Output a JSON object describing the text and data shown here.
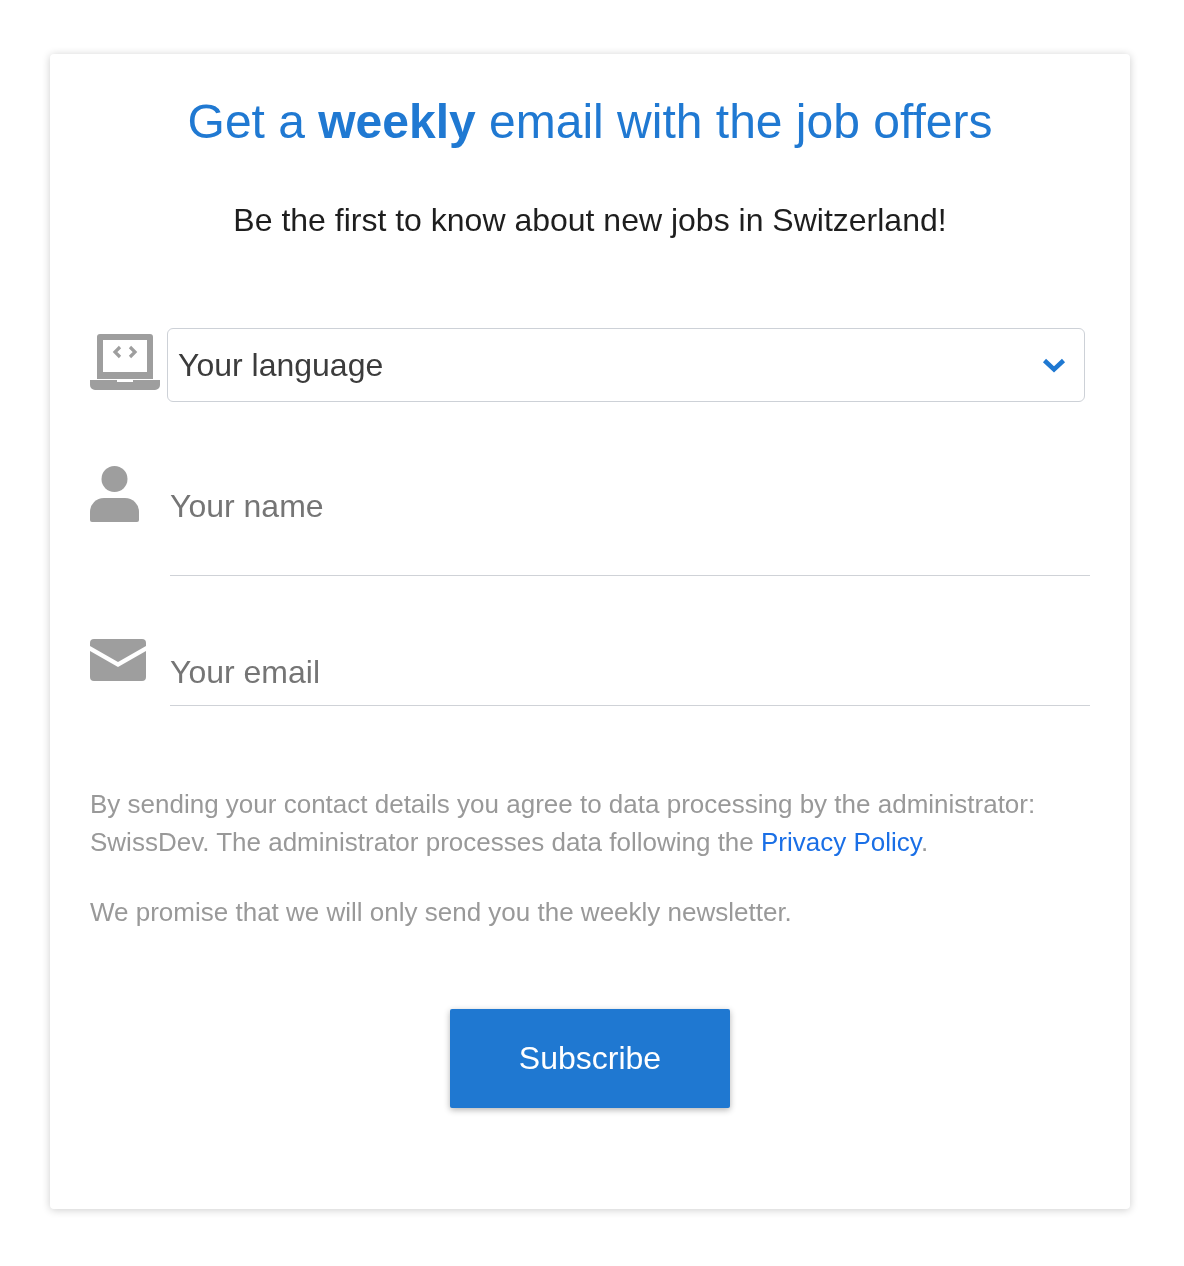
{
  "title": "Get a **weekly** email with the job offers",
  "subtitle": "Be the first to know about new jobs in Switzerland!",
  "fields": [
    {
      "kind": "select",
      "value": "Your language"
    },
    {
      "kind": "text",
      "placeholder": "Your name"
    },
    {
      "kind": "text",
      "placeholder": "Your email"
    }
  ],
  "consent": {
    "text": "By sending your contact details you agree to data processing by the administrator: SwissDev. The administrator processes data following the",
    "link": "Privacy Policy",
    "after": "."
  },
  "promise": "We promise that we will only send you the weekly newsletter.",
  "button": "Subscribe"
}
